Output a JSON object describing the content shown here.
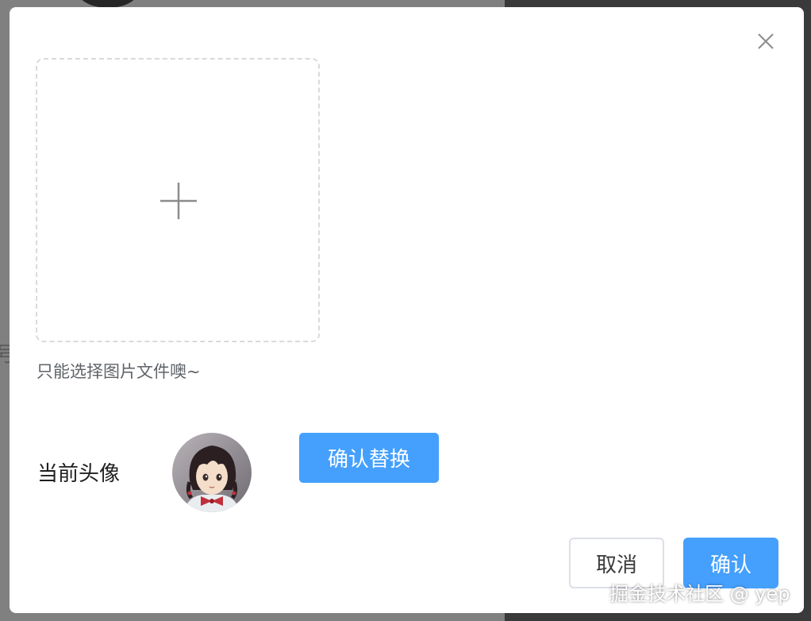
{
  "background": {
    "partial_glyph": "号"
  },
  "dialog": {
    "upload": {
      "hint": "只能选择图片文件噢~"
    },
    "current_avatar": {
      "label": "当前头像"
    },
    "replace_button_label": "确认替换",
    "footer": {
      "cancel_label": "取消",
      "confirm_label": "确认"
    }
  },
  "icons": {
    "close": "close-icon",
    "upload": "plus-icon",
    "avatar": "anime-girl-avatar"
  },
  "colors": {
    "primary": "#45a0fd",
    "upload_border": "#dadada",
    "hint_text": "#5f6368",
    "overlay": "#808080"
  },
  "watermark": "掘金技术社区 @ yep"
}
